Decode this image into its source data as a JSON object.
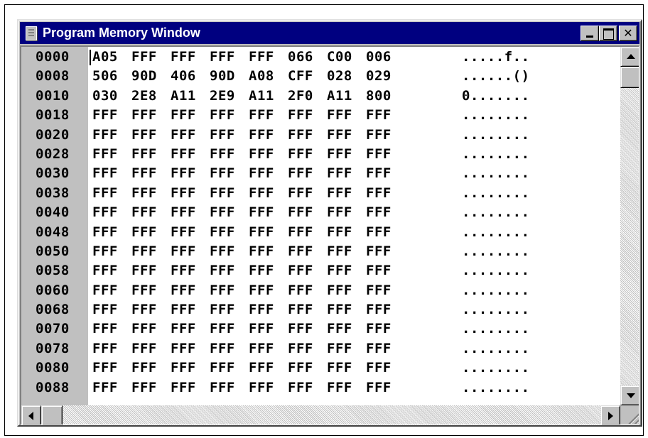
{
  "window": {
    "title": "Program Memory Window",
    "icon": "document-icon",
    "close_glyph": "✕"
  },
  "memory": {
    "rows": [
      {
        "address": "0000",
        "words": [
          "A05",
          "FFF",
          "FFF",
          "FFF",
          "FFF",
          "066",
          "C00",
          "006"
        ],
        "ascii": ".....f.."
      },
      {
        "address": "0008",
        "words": [
          "506",
          "90D",
          "406",
          "90D",
          "A08",
          "CFF",
          "028",
          "029"
        ],
        "ascii": "......()"
      },
      {
        "address": "0010",
        "words": [
          "030",
          "2E8",
          "A11",
          "2E9",
          "A11",
          "2F0",
          "A11",
          "800"
        ],
        "ascii": "0......."
      },
      {
        "address": "0018",
        "words": [
          "FFF",
          "FFF",
          "FFF",
          "FFF",
          "FFF",
          "FFF",
          "FFF",
          "FFF"
        ],
        "ascii": "........"
      },
      {
        "address": "0020",
        "words": [
          "FFF",
          "FFF",
          "FFF",
          "FFF",
          "FFF",
          "FFF",
          "FFF",
          "FFF"
        ],
        "ascii": "........"
      },
      {
        "address": "0028",
        "words": [
          "FFF",
          "FFF",
          "FFF",
          "FFF",
          "FFF",
          "FFF",
          "FFF",
          "FFF"
        ],
        "ascii": "........"
      },
      {
        "address": "0030",
        "words": [
          "FFF",
          "FFF",
          "FFF",
          "FFF",
          "FFF",
          "FFF",
          "FFF",
          "FFF"
        ],
        "ascii": "........"
      },
      {
        "address": "0038",
        "words": [
          "FFF",
          "FFF",
          "FFF",
          "FFF",
          "FFF",
          "FFF",
          "FFF",
          "FFF"
        ],
        "ascii": "........"
      },
      {
        "address": "0040",
        "words": [
          "FFF",
          "FFF",
          "FFF",
          "FFF",
          "FFF",
          "FFF",
          "FFF",
          "FFF"
        ],
        "ascii": "........"
      },
      {
        "address": "0048",
        "words": [
          "FFF",
          "FFF",
          "FFF",
          "FFF",
          "FFF",
          "FFF",
          "FFF",
          "FFF"
        ],
        "ascii": "........"
      },
      {
        "address": "0050",
        "words": [
          "FFF",
          "FFF",
          "FFF",
          "FFF",
          "FFF",
          "FFF",
          "FFF",
          "FFF"
        ],
        "ascii": "........"
      },
      {
        "address": "0058",
        "words": [
          "FFF",
          "FFF",
          "FFF",
          "FFF",
          "FFF",
          "FFF",
          "FFF",
          "FFF"
        ],
        "ascii": "........"
      },
      {
        "address": "0060",
        "words": [
          "FFF",
          "FFF",
          "FFF",
          "FFF",
          "FFF",
          "FFF",
          "FFF",
          "FFF"
        ],
        "ascii": "........"
      },
      {
        "address": "0068",
        "words": [
          "FFF",
          "FFF",
          "FFF",
          "FFF",
          "FFF",
          "FFF",
          "FFF",
          "FFF"
        ],
        "ascii": "........"
      },
      {
        "address": "0070",
        "words": [
          "FFF",
          "FFF",
          "FFF",
          "FFF",
          "FFF",
          "FFF",
          "FFF",
          "FFF"
        ],
        "ascii": "........"
      },
      {
        "address": "0078",
        "words": [
          "FFF",
          "FFF",
          "FFF",
          "FFF",
          "FFF",
          "FFF",
          "FFF",
          "FFF"
        ],
        "ascii": "........"
      },
      {
        "address": "0080",
        "words": [
          "FFF",
          "FFF",
          "FFF",
          "FFF",
          "FFF",
          "FFF",
          "FFF",
          "FFF"
        ],
        "ascii": "........"
      },
      {
        "address": "0088",
        "words": [
          "FFF",
          "FFF",
          "FFF",
          "FFF",
          "FFF",
          "FFF",
          "FFF",
          "FFF"
        ],
        "ascii": "........"
      }
    ]
  },
  "colors": {
    "titlebar": "#000080",
    "title_text": "#ffffff",
    "address_gutter": "#c0c0c0",
    "content_bg": "#ffffff"
  }
}
